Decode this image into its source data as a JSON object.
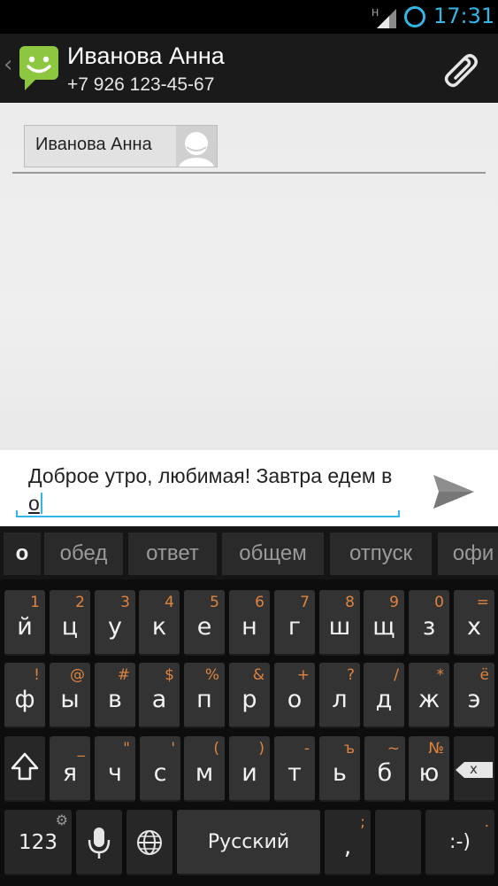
{
  "status_bar": {
    "time": "17:31",
    "network_label": "H"
  },
  "action_bar": {
    "contact_name": "Иванова Анна",
    "contact_phone": "+7 926 123-45-67",
    "icons": [
      "back-chevron-icon",
      "messaging-app-icon",
      "paperclip-attach-icon"
    ]
  },
  "recipients": {
    "chip_label": "Иванова Анна"
  },
  "compose": {
    "text_before": "Доброе утро, любимая! Завтра едем в ",
    "text_typed": "о",
    "send_icon": "send-arrow-icon"
  },
  "keyboard": {
    "suggestions": [
      "о",
      "обед",
      "ответ",
      "общем",
      "отпуск",
      "офи"
    ],
    "row1": {
      "main": [
        "й",
        "ц",
        "у",
        "к",
        "е",
        "н",
        "г",
        "ш",
        "щ",
        "з",
        "х"
      ],
      "alt": [
        "1",
        "2",
        "3",
        "4",
        "5",
        "6",
        "7",
        "8",
        "9",
        "0",
        "="
      ]
    },
    "row2": {
      "main": [
        "ф",
        "ы",
        "в",
        "а",
        "п",
        "р",
        "о",
        "л",
        "д",
        "ж",
        "э"
      ],
      "alt": [
        "!",
        "@",
        "#",
        "$",
        "%",
        "&",
        "+",
        "?",
        "/",
        "*",
        "ё"
      ]
    },
    "row3": {
      "main": [
        "я",
        "ч",
        "с",
        "м",
        "и",
        "т",
        "ь",
        "б",
        "ю"
      ],
      "alt": [
        "_",
        "\"",
        "'",
        "(",
        ")",
        "-",
        "ъ",
        "~",
        "№"
      ]
    },
    "shift_icon": "shift-arrow-icon",
    "delete_icon": "backspace-icon",
    "delete_label": "x",
    "numbers_label": "123",
    "mic_icon": "microphone-icon",
    "globe_icon": "globe-icon",
    "space_label": "Русский",
    "comma_main": ",",
    "comma_alt": ";",
    "smiley_main": ":-)",
    "smiley_alt": "."
  },
  "colors": {
    "accent": "#33b5e5",
    "key_alt": "#e0833f",
    "key_bg": "#333333"
  }
}
